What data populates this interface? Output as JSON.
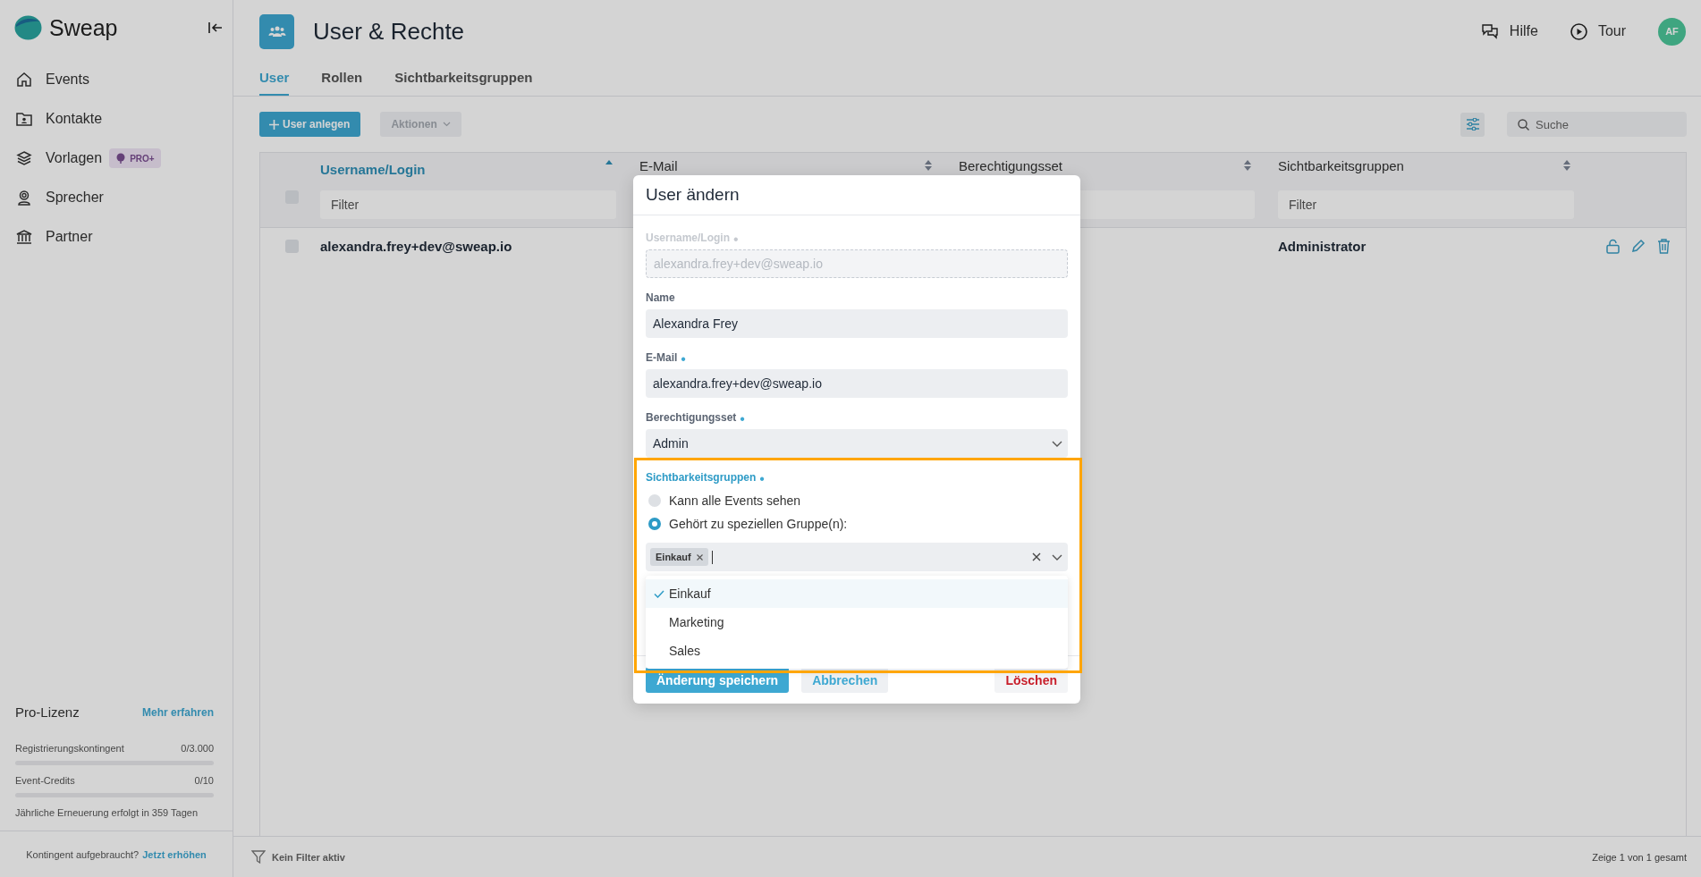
{
  "sidebar": {
    "brand": "Sweap",
    "items": [
      {
        "label": "Events",
        "kind": "home"
      },
      {
        "label": "Kontakte",
        "kind": "contacts"
      },
      {
        "label": "Vorlagen",
        "kind": "layers",
        "badge": "PRO+"
      },
      {
        "label": "Sprecher",
        "kind": "speaker"
      },
      {
        "label": "Partner",
        "kind": "bank"
      }
    ],
    "license": {
      "title": "Pro-Lizenz",
      "link": "Mehr erfahren",
      "meters": [
        {
          "label": "Registrierungskontingent",
          "reading": "0/3.000",
          "level": 0
        },
        {
          "label": "Event-Credits",
          "reading": "0/10",
          "level": 0
        }
      ],
      "renewal": "Jährliche Erneuerung erfolgt in 359 Tagen",
      "footer_text": "Kontingent aufgebraucht?",
      "footer_link": "Jetzt erhöhen"
    }
  },
  "header": {
    "title": "User & Rechte",
    "help": "Hilfe",
    "tour": "Tour",
    "avatar": "AF"
  },
  "tabs": [
    {
      "label": "User",
      "selected": true
    },
    {
      "label": "Rollen",
      "selected": false
    },
    {
      "label": "Sichtbarkeitsgruppen",
      "selected": false
    }
  ],
  "toolbar": {
    "create": "User anlegen",
    "actions": {
      "label": "Aktionen",
      "disabled": true
    },
    "search": {
      "placeholder": "Suche"
    }
  },
  "table": {
    "all_checked": false,
    "columns": [
      {
        "label": "Username/Login",
        "sorted": true,
        "filter_placeholder": "Filter"
      },
      {
        "label": "E-Mail",
        "sorted": false
      },
      {
        "label": "Berechtigungsset",
        "sorted": false
      },
      {
        "label": "Sichtbarkeitsgruppen",
        "sorted": false,
        "filter_placeholder": "Filter"
      }
    ],
    "rows": [
      {
        "checked": false,
        "username": "alexandra.frey+dev@sweap.io",
        "visibility_groups": "Administrator"
      }
    ]
  },
  "footer": {
    "filter_status": "Kein Filter aktiv",
    "count": "Zeige 1 von 1 gesamt"
  },
  "modal": {
    "title": "User ändern",
    "fields": [
      {
        "kind": "text",
        "label": "Username/Login",
        "required_mark": "•",
        "disabled": true,
        "value": "alexandra.frey+dev@sweap.io"
      },
      {
        "kind": "text",
        "label": "Name",
        "disabled": false,
        "value": "Alexandra Frey"
      },
      {
        "kind": "text",
        "label": "E-Mail",
        "required_mark": "•",
        "disabled": false,
        "value": "alexandra.frey+dev@sweap.io"
      },
      {
        "kind": "select",
        "label": "Berechtigungsset",
        "required_mark": "•",
        "value": "Admin"
      }
    ],
    "visibility": {
      "label": "Sichtbarkeitsgruppen",
      "required_mark": "•",
      "focused": true,
      "highlighted": true,
      "options": [
        {
          "label": "Kann alle Events sehen",
          "selected": false
        },
        {
          "label": "Gehört zu speziellen Gruppe(n):",
          "selected": true
        }
      ],
      "tags": [
        "Einkauf"
      ],
      "dropdown": [
        {
          "label": "Einkauf",
          "selected": true
        },
        {
          "label": "Marketing",
          "selected": false
        },
        {
          "label": "Sales",
          "selected": false
        }
      ]
    },
    "buttons": [
      {
        "kind": "primary",
        "label": "Änderung speichern"
      },
      {
        "kind": "secondary",
        "label": "Abbrechen"
      },
      {
        "kind": "danger",
        "label": "Löschen"
      }
    ]
  }
}
